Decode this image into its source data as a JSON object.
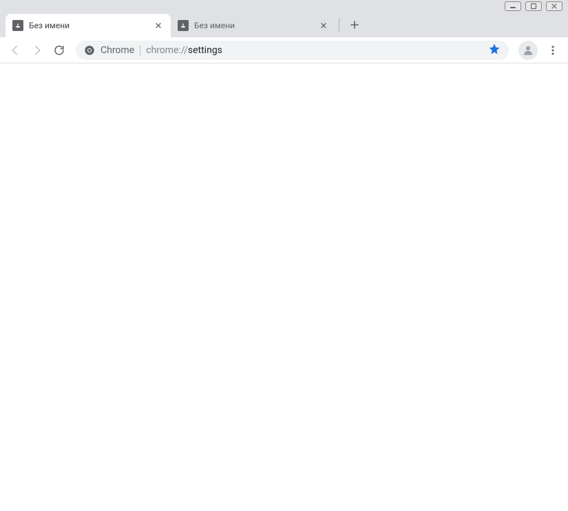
{
  "tabs": [
    {
      "title": "Без имени",
      "active": true
    },
    {
      "title": "Без имени",
      "active": false
    }
  ],
  "omnibox": {
    "secure_label": "Chrome",
    "url_scheme": "chrome://",
    "url_path": "settings"
  }
}
